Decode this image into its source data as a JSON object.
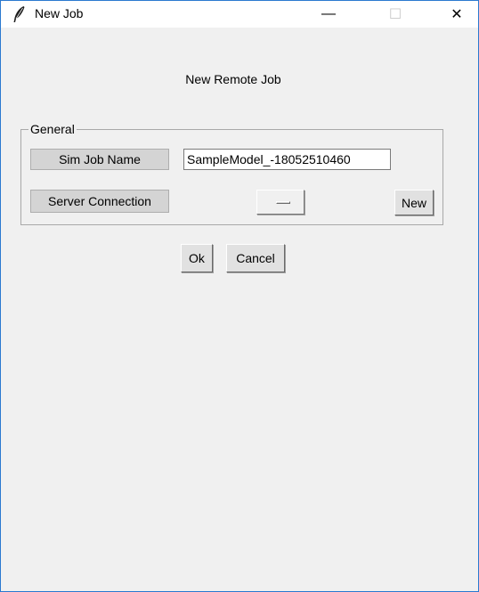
{
  "window": {
    "title": "New Job",
    "minimize_glyph": "—",
    "maximize_glyph": "☐",
    "close_glyph": "✕",
    "app_icon": "feather-icon"
  },
  "dialog": {
    "heading": "New Remote Job"
  },
  "group": {
    "legend": "General",
    "sim_job_name_label": "Sim Job Name",
    "sim_job_name_value": "SampleModel_-18052510460",
    "server_connection_label": "Server Connection",
    "server_connection_value": "",
    "new_button": "New"
  },
  "actions": {
    "ok": "Ok",
    "cancel": "Cancel"
  },
  "colors": {
    "window_border": "#2b79d0",
    "client_bg": "#f0f0f0",
    "titlebar_bg": "#ffffff"
  }
}
